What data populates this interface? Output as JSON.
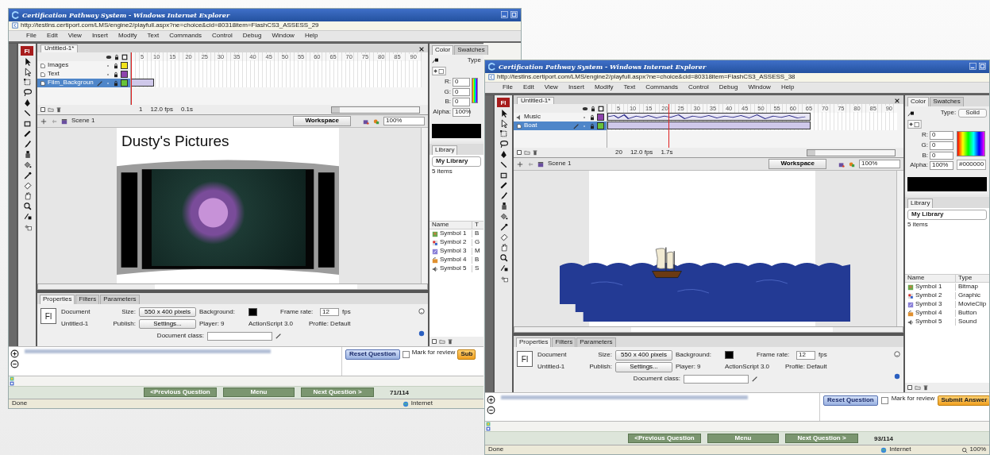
{
  "windows": [
    {
      "title": "Certification Pathway System - Windows Internet Explorer",
      "url": "http://testlns.certiport.com/LMS/engine2/playfull.aspx?ne=choice&cid=80318item=FlashCS3_ASSESS_29",
      "menu": [
        "File",
        "Edit",
        "View",
        "Insert",
        "Modify",
        "Text",
        "Commands",
        "Control",
        "Debug",
        "Window",
        "Help"
      ],
      "app_logo": "Fl",
      "document_tab": "Untitled-1*",
      "ruler": [
        "5",
        "10",
        "15",
        "20",
        "25",
        "30",
        "35",
        "40",
        "45",
        "50",
        "55",
        "60",
        "65",
        "70",
        "75",
        "80",
        "85",
        "90"
      ],
      "layers": [
        {
          "name": "Images",
          "kind": "normal",
          "color": "#f2e21b",
          "selected": false,
          "level": 0
        },
        {
          "name": "Text",
          "kind": "normal",
          "color": "#8e44ad",
          "selected": false,
          "level": 0
        },
        {
          "name": "Film_Backgroun",
          "kind": "normal",
          "color": "#66c23a",
          "selected": true,
          "level": 0.08
        }
      ],
      "playhead": {
        "level": 0
      },
      "timeline_status": {
        "frame": "1",
        "fps": "12.0 fps",
        "time": "0.1s"
      },
      "scene": "Scene 1",
      "workspace": "Workspace",
      "zoom": "100%",
      "stage": {
        "kind": "photo",
        "heading": "Dusty's Pictures"
      },
      "properties": {
        "tabs": [
          {
            "label": "Properties",
            "selected": true
          },
          {
            "label": "Filters",
            "selected": false
          },
          {
            "label": "Parameters",
            "selected": false
          }
        ],
        "doc_icon": "Fl",
        "doc_label": "Document",
        "doc_name": "Untitled-1",
        "size_label": "Size:",
        "size_value": "550 x 400 pixels",
        "publish_label": "Publish:",
        "settings": "Settings...",
        "background_label": "Background:",
        "player": "Player: 9",
        "actionscript": "ActionScript 3.0",
        "frame_rate_label": "Frame rate:",
        "frame_rate": "12",
        "fps": "fps",
        "profile": "Profile: Default",
        "doc_class_label": "Document class:"
      },
      "color_panel": {
        "tabs": [
          {
            "label": "Color",
            "selected": true
          },
          {
            "label": "Swatches",
            "selected": false
          }
        ],
        "type_label": "Type",
        "channels": [
          {
            "label": "R:",
            "value": "0"
          },
          {
            "label": "G:",
            "value": "0"
          },
          {
            "label": "B:",
            "value": "0"
          },
          {
            "label": "Alpha:",
            "value": "100%"
          }
        ]
      },
      "library": {
        "tab": "Library",
        "name": "My Library",
        "count": "5 items",
        "columns": [
          "Name",
          "T"
        ],
        "items": [
          {
            "name": "Symbol 1",
            "kind": "bitmap",
            "type": "B"
          },
          {
            "name": "Symbol 2",
            "kind": "graphic",
            "type": "G"
          },
          {
            "name": "Symbol 3",
            "kind": "movieclip",
            "type": "M"
          },
          {
            "name": "Symbol 4",
            "kind": "button",
            "type": "B"
          },
          {
            "name": "Symbol 5",
            "kind": "sound",
            "type": "S"
          }
        ]
      },
      "question": {
        "reset": "Reset Question",
        "mark": "Mark for review",
        "mark_checked": false,
        "submit": "Sub"
      },
      "nav": {
        "previous": "<Previous Question",
        "menu": "Menu",
        "next": "Next Question >",
        "progress": "71/114"
      },
      "status": {
        "text": "Done",
        "zone": "Internet"
      }
    },
    {
      "title": "Certification Pathway System - Windows Internet Explorer",
      "url": "http://testlns.certiport.com/LMS/engine2/playfull.aspx?ne=choice&cid=80318item=FlashCS3_ASSESS_38",
      "menu": [
        "File",
        "Edit",
        "View",
        "Insert",
        "Modify",
        "Text",
        "Commands",
        "Control",
        "Debug",
        "Window",
        "Help"
      ],
      "app_logo": "Fl",
      "document_tab": "Untitled-1*",
      "ruler": [
        "5",
        "10",
        "15",
        "20",
        "25",
        "30",
        "35",
        "40",
        "45",
        "50",
        "55",
        "60",
        "65",
        "70",
        "75",
        "80",
        "85",
        "90"
      ],
      "layers": [
        {
          "name": "Music",
          "kind": "sound",
          "color": "#8e44ad",
          "selected": false,
          "level": 0.7
        },
        {
          "name": "Boat",
          "kind": "normal",
          "color": "#66c23a",
          "selected": true,
          "level": 0.7
        }
      ],
      "playhead": {
        "level": 0.21
      },
      "timeline_status": {
        "frame": "20",
        "fps": "12.0 fps",
        "time": "1.7s"
      },
      "scene": "Scene 1",
      "workspace": "Workspace",
      "zoom": "100%",
      "stage": {
        "kind": "boat"
      },
      "properties": {
        "tabs": [
          {
            "label": "Properties",
            "selected": true
          },
          {
            "label": "Filters",
            "selected": false
          },
          {
            "label": "Parameters",
            "selected": false
          }
        ],
        "doc_icon": "Fl",
        "doc_label": "Document",
        "doc_name": "Untitled-1",
        "size_label": "Size:",
        "size_value": "550 x 400 pixels",
        "publish_label": "Publish:",
        "settings": "Settings...",
        "background_label": "Background:",
        "player": "Player: 9",
        "actionscript": "ActionScript 3.0",
        "frame_rate_label": "Frame rate:",
        "frame_rate": "12",
        "fps": "fps",
        "profile": "Profile: Default",
        "doc_class_label": "Document class:"
      },
      "color_panel": {
        "tabs": [
          {
            "label": "Color",
            "selected": true
          },
          {
            "label": "Swatches",
            "selected": false
          }
        ],
        "type_label": "Type:",
        "type_value": "Solid",
        "channels": [
          {
            "label": "R:",
            "value": "0"
          },
          {
            "label": "G:",
            "value": "0"
          },
          {
            "label": "B:",
            "value": "0"
          },
          {
            "label": "Alpha:",
            "value": "100%"
          }
        ],
        "hex": "#000000"
      },
      "library": {
        "tab": "Library",
        "name": "My Library",
        "count": "5 items",
        "columns": [
          "Name",
          "Type"
        ],
        "items": [
          {
            "name": "Symbol 1",
            "kind": "bitmap",
            "type": "Bitmap"
          },
          {
            "name": "Symbol 2",
            "kind": "graphic",
            "type": "Graphic"
          },
          {
            "name": "Symbol 3",
            "kind": "movieclip",
            "type": "MovieClip"
          },
          {
            "name": "Symbol 4",
            "kind": "button",
            "type": "Button"
          },
          {
            "name": "Symbol 5",
            "kind": "sound",
            "type": "Sound"
          }
        ]
      },
      "question": {
        "reset": "Reset Question",
        "mark": "Mark for review",
        "mark_checked": false,
        "submit": "Submit Answer"
      },
      "nav": {
        "previous": "<Previous Question",
        "menu": "Menu",
        "next": "Next Question >",
        "progress": "93/114"
      },
      "status": {
        "text": "Done",
        "zone": "Internet",
        "zoom": "100%"
      }
    }
  ]
}
